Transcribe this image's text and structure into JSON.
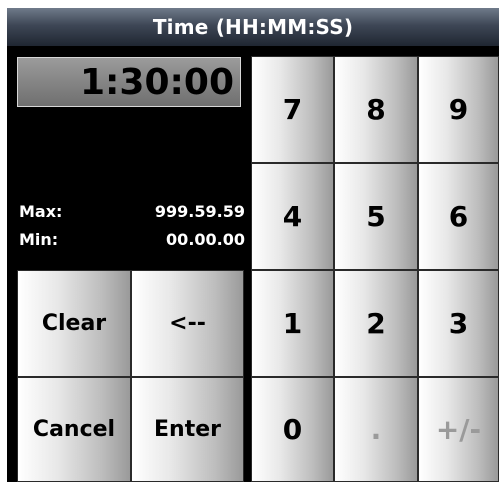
{
  "window": {
    "title": "Time (HH:MM:SS)"
  },
  "display": {
    "value": "1:30:00"
  },
  "limits": {
    "max_label": "Max:",
    "max_value": "999.59.59",
    "min_label": "Min:",
    "min_value": "00.00.00"
  },
  "actions": {
    "clear": "Clear",
    "backspace": "<--",
    "cancel": "Cancel",
    "enter": "Enter"
  },
  "keypad": {
    "k7": "7",
    "k8": "8",
    "k9": "9",
    "k4": "4",
    "k5": "5",
    "k6": "6",
    "k1": "1",
    "k2": "2",
    "k3": "3",
    "k0": "0",
    "dot": ".",
    "plusminus": "+/-"
  }
}
